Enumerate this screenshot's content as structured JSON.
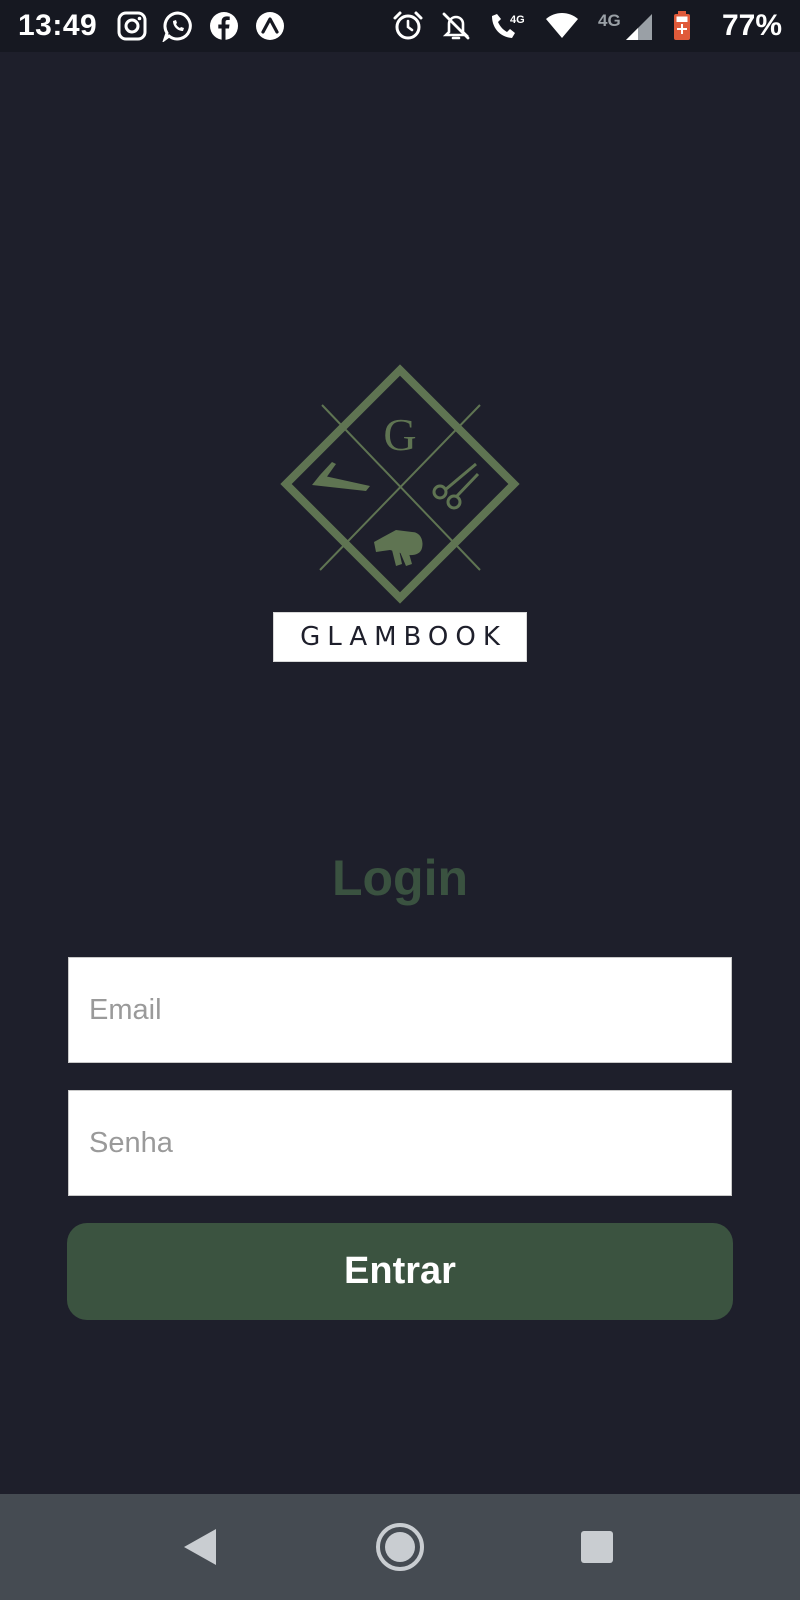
{
  "status_bar": {
    "time": "13:49",
    "battery_percent": "77%",
    "left_icons": [
      "instagram-icon",
      "whatsapp-icon",
      "facebook-icon",
      "expo-icon"
    ],
    "right_icons": [
      "alarm-icon",
      "notifications-off-icon",
      "wifi-calling-icon",
      "wifi-icon",
      "signal-icon",
      "battery-icon"
    ],
    "network_label": "4G",
    "call_network_label": "4G"
  },
  "logo": {
    "monogram": "G",
    "brand_name": "GLAMBOOK",
    "accent_color": "#5f7452"
  },
  "login": {
    "title": "Login",
    "title_color": "#3a5240",
    "email_placeholder": "Email",
    "password_placeholder": "Senha",
    "submit_label": "Entrar",
    "button_color": "#3b5340"
  },
  "nav_bar": {
    "icons": [
      "back-icon",
      "home-icon",
      "recents-icon"
    ]
  },
  "colors": {
    "background": "#1e1f2b",
    "status_bar": "#161821",
    "nav_bar": "#454b52"
  }
}
